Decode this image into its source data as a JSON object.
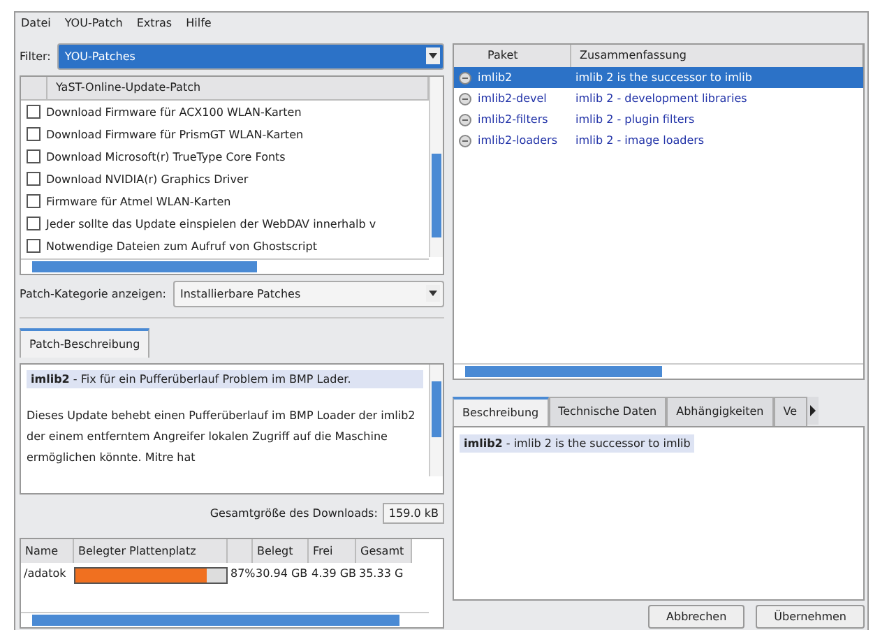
{
  "menu": [
    "Datei",
    "YOU-Patch",
    "Extras",
    "Hilfe"
  ],
  "filter": {
    "label": "Filter:",
    "value": "YOU-Patches"
  },
  "patch_list": {
    "column": "YaST-Online-Update-Patch",
    "rows": [
      {
        "label": "Download Firmware für ACX100 WLAN-Karten",
        "checked": false
      },
      {
        "label": "Download Firmware für PrismGT WLAN-Karten",
        "checked": false
      },
      {
        "label": "Download Microsoft(r) TrueType Core Fonts",
        "checked": false
      },
      {
        "label": "Download NVIDIA(r) Graphics Driver",
        "checked": false
      },
      {
        "label": "Firmware für Atmel WLAN-Karten",
        "checked": false
      },
      {
        "label": "Jeder sollte das Update einspielen der WebDAV innerhalb v",
        "checked": false
      },
      {
        "label": "Notwendige Dateien zum Aufruf von Ghostscript",
        "checked": false
      }
    ]
  },
  "category": {
    "label": "Patch-Kategorie anzeigen:",
    "value": "Installierbare Patches"
  },
  "patch_tabs": [
    {
      "label": "Patch-Beschreibung",
      "selected": true
    }
  ],
  "patch_description": {
    "heading": "**imlib2** - Fix für ein Pufferüberlauf Problem im BMP Lader.",
    "body": "Dieses Update behebt einen Pufferüberlauf im BMP Loader der imlib2 der einem entferntem Angreifer lokalen Zugriff auf die Maschine ermöglichen könnte. Mitre hat"
  },
  "download_size": {
    "label": "Gesamtgröße des Downloads:",
    "value": "159.0 kB"
  },
  "disk_table": {
    "columns": [
      "Name",
      "Belegter Plattenplatz",
      "",
      "Belegt",
      "Frei",
      "Gesamt"
    ],
    "rows": [
      {
        "name": "/adatok",
        "level": 0.87,
        "percent": "87%",
        "used": "30.94 GB",
        "free": "4.39 GB",
        "total": "35.33 G"
      }
    ]
  },
  "package_list": {
    "columns": [
      "Paket",
      "Zusammenfassung"
    ],
    "rows": [
      {
        "name": "imlib2",
        "summary": "imlib 2 is the successor to imlib",
        "selected": true
      },
      {
        "name": "imlib2-devel",
        "summary": "imlib 2 - development libraries",
        "selected": false
      },
      {
        "name": "imlib2-filters",
        "summary": "imlib 2 - plugin filters",
        "selected": false
      },
      {
        "name": "imlib2-loaders",
        "summary": "imlib 2 - image loaders",
        "selected": false
      }
    ]
  },
  "package_tabs": [
    {
      "label": "Beschreibung",
      "selected": true
    },
    {
      "label": "Technische Daten",
      "selected": false
    },
    {
      "label": "Abhängigkeiten",
      "selected": false
    },
    {
      "label": "Ve",
      "selected": false
    }
  ],
  "package_description": "**imlib2** - imlib 2 is the successor to imlib",
  "buttons": [
    "Abbrechen",
    "Übernehmen"
  ]
}
